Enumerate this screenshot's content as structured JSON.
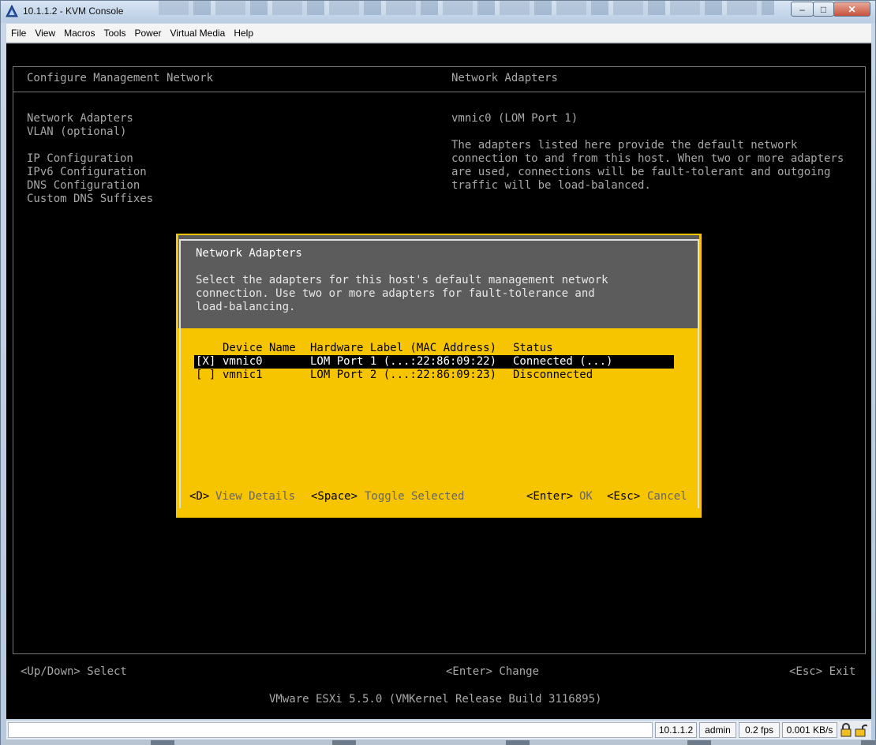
{
  "window": {
    "title": "10.1.1.2 - KVM Console",
    "minimize": "‒",
    "maximize": "□",
    "close": "✕"
  },
  "menu": [
    "File",
    "View",
    "Macros",
    "Tools",
    "Power",
    "Virtual Media",
    "Help"
  ],
  "console": {
    "left_header": "Configure Management Network",
    "right_header": "Network Adapters",
    "nav_items": [
      "Network Adapters",
      "VLAN (optional)",
      "IP Configuration",
      "IPv6 Configuration",
      "DNS Configuration",
      "Custom DNS Suffixes"
    ],
    "right_subtitle": "vmnic0 (LOM Port 1)",
    "right_description": [
      "The adapters listed here provide the default network",
      "connection to and from this host. When two or more adapters",
      "are used, connections will be fault-tolerant and outgoing",
      "traffic will be load-balanced."
    ],
    "footer_select": "<Up/Down> Select",
    "footer_change": "<Enter> Change",
    "footer_exit": "<Esc> Exit",
    "version": "VMware ESXi 5.5.0 (VMKernel Release Build 3116895)"
  },
  "dialog": {
    "title": "Network Adapters",
    "description": [
      "Select the adapters for this host's default management network",
      "connection. Use two or more adapters for fault-tolerance and",
      "load-balancing."
    ],
    "columns": {
      "device": "Device Name",
      "hardware": "Hardware Label (MAC Address)",
      "status": "Status"
    },
    "rows": [
      {
        "check": "[X]",
        "device": "vmnic0",
        "hardware": "LOM Port 1 (...:22:86:09:22)",
        "status": "Connected (...)"
      },
      {
        "check": "[ ]",
        "device": "vmnic1",
        "hardware": "LOM Port 2 (...:22:86:09:23)",
        "status": "Disconnected"
      }
    ],
    "keys": {
      "details_key": "<D>",
      "details_label": "View Details",
      "toggle_key": "<Space>",
      "toggle_label": "Toggle Selected",
      "ok_key": "<Enter>",
      "ok_label": "OK",
      "cancel_key": "<Esc>",
      "cancel_label": "Cancel"
    }
  },
  "statusbar": {
    "host": "10.1.1.2",
    "user": "admin",
    "fps": "0.2 fps",
    "rate": "0.001 KB/s"
  },
  "colors": {
    "dialog_background": "#f7c400",
    "dialog_header": "#5c5c5c",
    "console_text": "#a8a8a8"
  }
}
